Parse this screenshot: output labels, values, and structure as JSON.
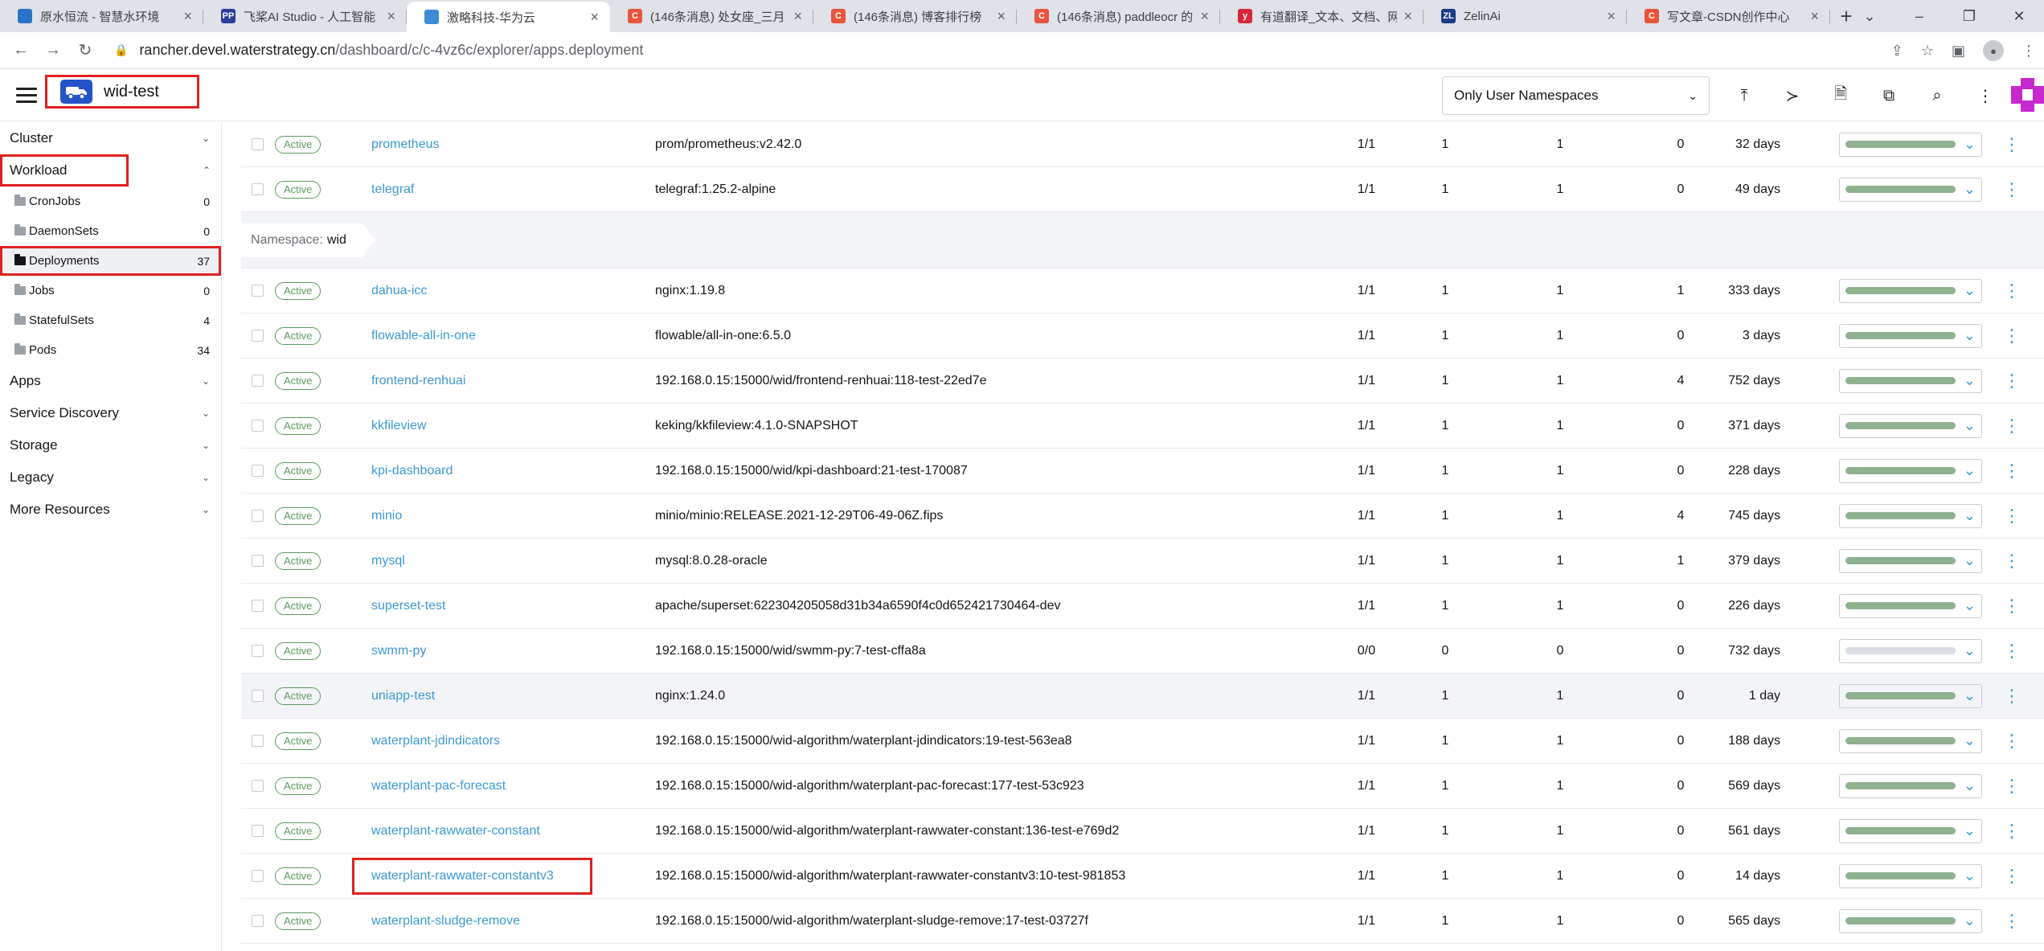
{
  "browser": {
    "tabs": [
      {
        "title": "原水恒流 - 智慧水环境",
        "icon_color": "#2a73c8",
        "icon_text": "",
        "active": false
      },
      {
        "title": "飞桨AI Studio - 人工智能",
        "icon_color": "#2b3d9e",
        "icon_text": "PP",
        "active": false
      },
      {
        "title": "激略科技-华为云",
        "icon_color": "#3b8ed6",
        "icon_text": "",
        "active": true
      },
      {
        "title": "(146条消息) 处女座_三月",
        "icon_color": "#e8543c",
        "icon_text": "C",
        "active": false
      },
      {
        "title": "(146条消息) 博客排行榜",
        "icon_color": "#e8543c",
        "icon_text": "C",
        "active": false
      },
      {
        "title": "(146条消息) paddleocr 的",
        "icon_color": "#e8543c",
        "icon_text": "C",
        "active": false
      },
      {
        "title": "有道翻译_文本、文档、网",
        "icon_color": "#d8263b",
        "icon_text": "y",
        "active": false
      },
      {
        "title": "ZelinAi",
        "icon_color": "#1c3a8a",
        "icon_text": "ZL",
        "active": false
      },
      {
        "title": "写文章-CSDN创作中心",
        "icon_color": "#e8543c",
        "icon_text": "C",
        "active": false
      }
    ],
    "url_host": "rancher.devel.waterstrategy.cn",
    "url_path": "/dashboard/c/c-4vz6c/explorer/apps.deployment"
  },
  "header": {
    "cluster_name": "wid-test",
    "namespace_filter": "Only User Namespaces"
  },
  "sidebar": {
    "groups_top": [
      {
        "label": "Cluster",
        "expanded": false
      }
    ],
    "workload": {
      "label": "Workload",
      "expanded": true
    },
    "workload_items": [
      {
        "label": "CronJobs",
        "count": "0"
      },
      {
        "label": "DaemonSets",
        "count": "0"
      },
      {
        "label": "Deployments",
        "count": "37",
        "active": true
      },
      {
        "label": "Jobs",
        "count": "0"
      },
      {
        "label": "StatefulSets",
        "count": "4"
      },
      {
        "label": "Pods",
        "count": "34"
      }
    ],
    "groups_bottom": [
      {
        "label": "Apps"
      },
      {
        "label": "Service Discovery"
      },
      {
        "label": "Storage"
      },
      {
        "label": "Legacy"
      },
      {
        "label": "More Resources"
      }
    ]
  },
  "table": {
    "state_label": "Active",
    "rows_before": [
      {
        "name": "prometheus",
        "image": "prom/prometheus:v2.42.0",
        "ready": "1/1",
        "up_to_date": "1",
        "available": "1",
        "restarts": "0",
        "age": "32 days",
        "health": 1.0
      },
      {
        "name": "telegraf",
        "image": "telegraf:1.25.2-alpine",
        "ready": "1/1",
        "up_to_date": "1",
        "available": "1",
        "restarts": "0",
        "age": "49 days",
        "health": 1.0
      }
    ],
    "namespace_group": {
      "prefix": "Namespace:",
      "name": "wid"
    },
    "rows_after": [
      {
        "name": "dahua-icc",
        "image": "nginx:1.19.8",
        "ready": "1/1",
        "up_to_date": "1",
        "available": "1",
        "restarts": "1",
        "age": "333 days",
        "health": 1.0
      },
      {
        "name": "flowable-all-in-one",
        "image": "flowable/all-in-one:6.5.0",
        "ready": "1/1",
        "up_to_date": "1",
        "available": "1",
        "restarts": "0",
        "age": "3 days",
        "health": 1.0
      },
      {
        "name": "frontend-renhuai",
        "image": "192.168.0.15:15000/wid/frontend-renhuai:118-test-22ed7e",
        "ready": "1/1",
        "up_to_date": "1",
        "available": "1",
        "restarts": "4",
        "age": "752 days",
        "health": 1.0
      },
      {
        "name": "kkfileview",
        "image": "keking/kkfileview:4.1.0-SNAPSHOT",
        "ready": "1/1",
        "up_to_date": "1",
        "available": "1",
        "restarts": "0",
        "age": "371 days",
        "health": 1.0
      },
      {
        "name": "kpi-dashboard",
        "image": "192.168.0.15:15000/wid/kpi-dashboard:21-test-170087",
        "ready": "1/1",
        "up_to_date": "1",
        "available": "1",
        "restarts": "0",
        "age": "228 days",
        "health": 1.0
      },
      {
        "name": "minio",
        "image": "minio/minio:RELEASE.2021-12-29T06-49-06Z.fips",
        "ready": "1/1",
        "up_to_date": "1",
        "available": "1",
        "restarts": "4",
        "age": "745 days",
        "health": 1.0
      },
      {
        "name": "mysql",
        "image": "mysql:8.0.28-oracle",
        "ready": "1/1",
        "up_to_date": "1",
        "available": "1",
        "restarts": "1",
        "age": "379 days",
        "health": 1.0
      },
      {
        "name": "superset-test",
        "image": "apache/superset:622304205058d31b34a6590f4c0d652421730464-dev",
        "ready": "1/1",
        "up_to_date": "1",
        "available": "1",
        "restarts": "0",
        "age": "226 days",
        "health": 1.0
      },
      {
        "name": "swmm-py",
        "image": "192.168.0.15:15000/wid/swmm-py:7-test-cffa8a",
        "ready": "0/0",
        "up_to_date": "0",
        "available": "0",
        "restarts": "0",
        "age": "732 days",
        "health": 0.0
      },
      {
        "name": "uniapp-test",
        "image": "nginx:1.24.0",
        "ready": "1/1",
        "up_to_date": "1",
        "available": "1",
        "restarts": "0",
        "age": "1 day",
        "health": 1.0,
        "hover": true
      },
      {
        "name": "waterplant-jdindicators",
        "image": "192.168.0.15:15000/wid-algorithm/waterplant-jdindicators:19-test-563ea8",
        "ready": "1/1",
        "up_to_date": "1",
        "available": "1",
        "restarts": "0",
        "age": "188 days",
        "health": 1.0
      },
      {
        "name": "waterplant-pac-forecast",
        "image": "192.168.0.15:15000/wid-algorithm/waterplant-pac-forecast:177-test-53c923",
        "ready": "1/1",
        "up_to_date": "1",
        "available": "1",
        "restarts": "0",
        "age": "569 days",
        "health": 1.0
      },
      {
        "name": "waterplant-rawwater-constant",
        "image": "192.168.0.15:15000/wid-algorithm/waterplant-rawwater-constant:136-test-e769d2",
        "ready": "1/1",
        "up_to_date": "1",
        "available": "1",
        "restarts": "0",
        "age": "561 days",
        "health": 1.0
      },
      {
        "name": "waterplant-rawwater-constantv3",
        "image": "192.168.0.15:15000/wid-algorithm/waterplant-rawwater-constantv3:10-test-981853",
        "ready": "1/1",
        "up_to_date": "1",
        "available": "1",
        "restarts": "0",
        "age": "14 days",
        "health": 1.0,
        "highlight": true
      },
      {
        "name": "waterplant-sludge-remove",
        "image": "192.168.0.15:15000/wid-algorithm/waterplant-sludge-remove:17-test-03727f",
        "ready": "1/1",
        "up_to_date": "1",
        "available": "1",
        "restarts": "0",
        "age": "565 days",
        "health": 1.0
      }
    ]
  },
  "colors": {
    "link": "#3d98d3",
    "active_state": "#5d995d",
    "health_ok": "#8fb18f",
    "highlight_box": "#e02020"
  }
}
